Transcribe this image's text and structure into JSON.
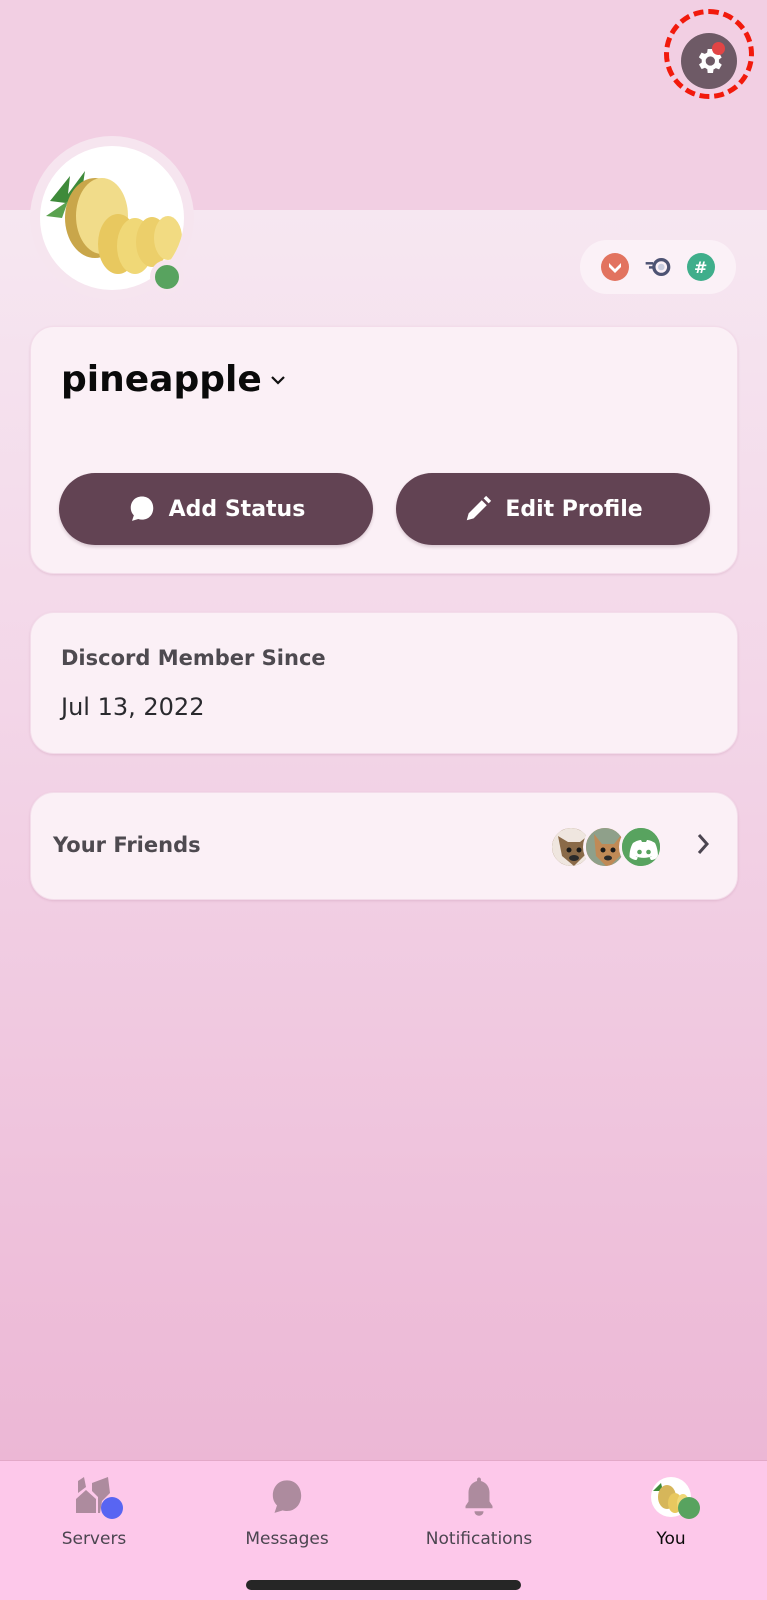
{
  "colors": {
    "accent": "#624353",
    "online": "#58a35f",
    "settings_highlight": "#f21a0c",
    "notification_dot": "#e24545",
    "servers_badge": "#5865f2",
    "tabbar_bg": "#fdc8ea"
  },
  "header": {
    "settings_icon": "gear-icon",
    "settings_has_notification": true
  },
  "profile": {
    "avatar": "pineapple-image",
    "status": "online",
    "badges": [
      {
        "name": "hypesquad-badge",
        "color": "#e2735f",
        "glyph": "chevron"
      },
      {
        "name": "nitro-speed-badge",
        "color": "#4d5373",
        "glyph": "speed"
      },
      {
        "name": "hashtag-badge",
        "color": "#3fae8b",
        "glyph": "#"
      }
    ],
    "username": "pineapple",
    "add_status_label": "Add Status",
    "edit_profile_label": "Edit Profile"
  },
  "member": {
    "label": "Discord Member Since",
    "date": "Jul 13, 2022"
  },
  "friends": {
    "label": "Your Friends",
    "avatars": [
      "dog-avatar-1",
      "dog-avatar-2",
      "discord-default-avatar"
    ]
  },
  "tabs": [
    {
      "label": "Servers",
      "icon": "servers-icon",
      "active": false
    },
    {
      "label": "Messages",
      "icon": "messages-icon",
      "active": false
    },
    {
      "label": "Notifications",
      "icon": "bell-icon",
      "active": false
    },
    {
      "label": "You",
      "icon": "user-avatar",
      "active": true
    }
  ]
}
